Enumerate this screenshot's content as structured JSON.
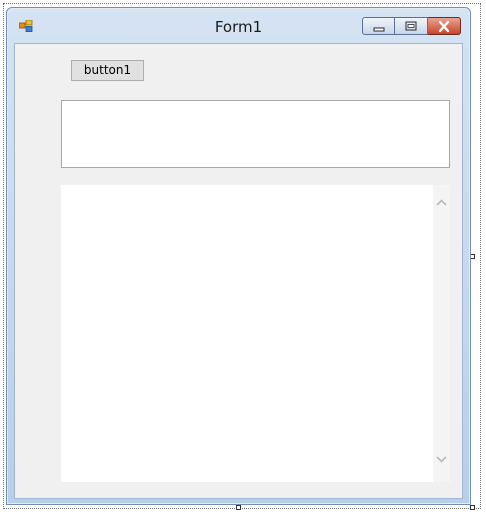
{
  "window": {
    "title": "Form1",
    "caption_buttons": [
      "minimize-icon",
      "maximize-icon",
      "close-icon"
    ],
    "colors": {
      "frame": "#b8cfe9",
      "client": "#f0f0f0",
      "close_button": "#c8442a"
    }
  },
  "controls": {
    "button1_label": "button1"
  },
  "scrollbar": {
    "up_icon": "chevron-up-icon",
    "down_icon": "chevron-down-icon"
  }
}
